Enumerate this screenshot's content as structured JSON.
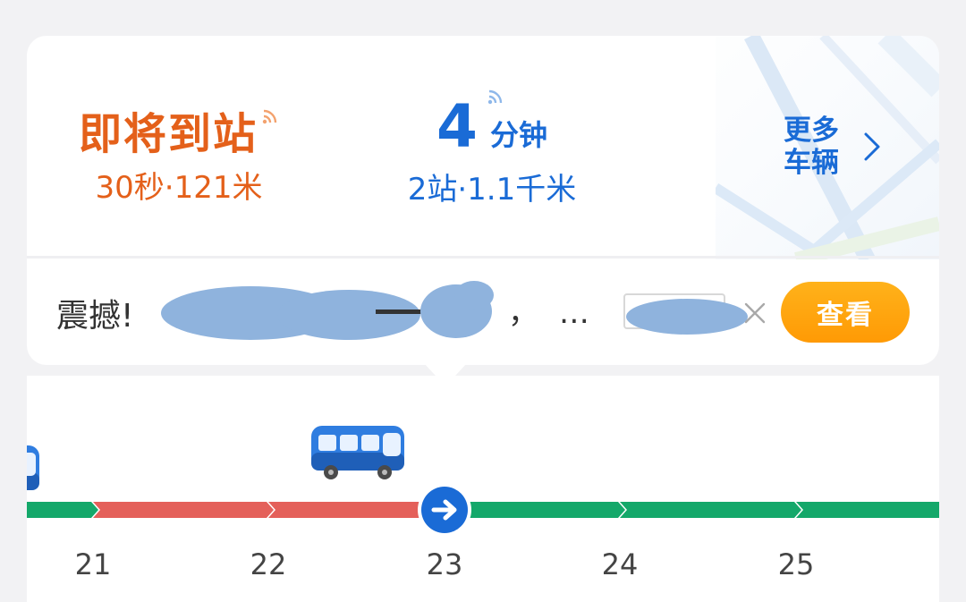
{
  "arrivals": [
    {
      "status": "即将到站",
      "detail": "30秒·121米",
      "color": "#e4601a"
    },
    {
      "minutes": "4",
      "unit": "分钟",
      "detail": "2站·1.1千米",
      "color": "#1a6bd6"
    }
  ],
  "more_vehicles": {
    "label": "更多\n车辆"
  },
  "news": {
    "text": "震撼!",
    "punctuation": "，",
    "ellipsis": "…",
    "button_label": "查看",
    "button_color": "#ffa40f"
  },
  "route": {
    "stops": [
      {
        "number": "21"
      },
      {
        "number": "22"
      },
      {
        "number": "23",
        "current": true
      },
      {
        "number": "24"
      },
      {
        "number": "25"
      }
    ],
    "segment_status": [
      "green",
      "red",
      "red",
      "green",
      "green",
      "green"
    ],
    "colors": {
      "green": "#14a86a",
      "red": "#e4605a",
      "current": "#1a6bd6"
    },
    "icons": {
      "bus": "bus-icon",
      "current": "arrow-right-icon"
    }
  }
}
